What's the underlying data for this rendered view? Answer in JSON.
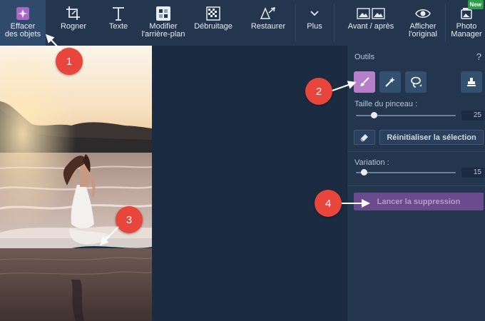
{
  "toolbar": {
    "tools": [
      {
        "label": "Effacer\ndes objets",
        "icon": "eraser-objects-icon"
      },
      {
        "label": "Rogner",
        "icon": "crop-icon"
      },
      {
        "label": "Texte",
        "icon": "text-icon"
      },
      {
        "label": "Modifier\nl'arrière-plan",
        "icon": "background-icon"
      },
      {
        "label": "Débruitage",
        "icon": "denoise-icon"
      },
      {
        "label": "Restaurer",
        "icon": "restore-icon"
      },
      {
        "label": "Plus",
        "icon": "chevron-down-icon"
      },
      {
        "label": "Avant / après",
        "icon": "before-after-icon"
      },
      {
        "label": "Afficher\nl'original",
        "icon": "eye-icon"
      },
      {
        "label": "Photo\nManager",
        "icon": "photo-manager-icon",
        "badge": "New"
      }
    ]
  },
  "panel": {
    "title": "Outils",
    "help": "?",
    "brush_size_label": "Taille du pinceau :",
    "brush_size_value": "25",
    "brush_size_fraction": 0.18,
    "reset_selection": "Réinitialiser la sélection",
    "variation_label": "Variation :",
    "variation_value": "15",
    "variation_fraction": 0.08,
    "launch_label": "Lancer la suppression"
  },
  "markers": [
    "1",
    "2",
    "3",
    "4"
  ],
  "colors": {
    "accent": "#b57fc9",
    "marker": "#e8453d",
    "toolbar_bg": "#24364d",
    "canvas_bg": "#1b2c42"
  }
}
